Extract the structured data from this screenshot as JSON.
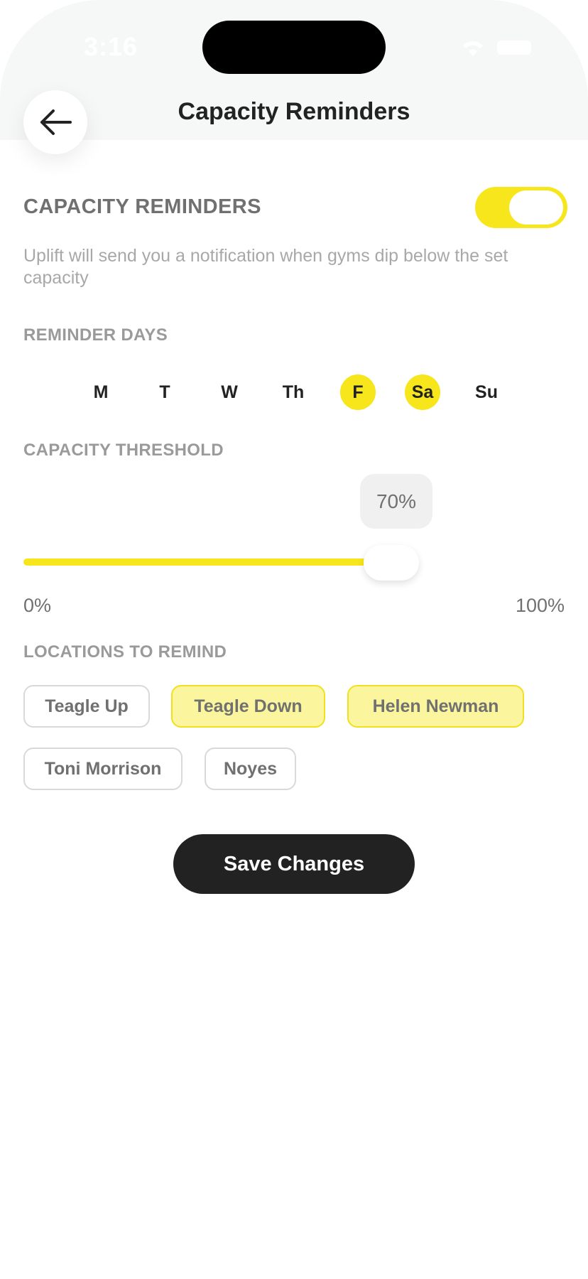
{
  "status_bar": {
    "time": "3:16",
    "wifi_icon": "wifi-icon",
    "battery_icon": "battery-icon"
  },
  "header": {
    "title": "Capacity Reminders",
    "back_icon": "arrow-left-icon"
  },
  "reminders": {
    "heading": "CAPACITY REMINDERS",
    "enabled": true,
    "description": "Uplift will send you a notification when gyms dip below the set capacity"
  },
  "days": {
    "heading": "REMINDER DAYS",
    "items": [
      {
        "label": "M",
        "selected": false
      },
      {
        "label": "T",
        "selected": false
      },
      {
        "label": "W",
        "selected": false
      },
      {
        "label": "Th",
        "selected": false
      },
      {
        "label": "F",
        "selected": true
      },
      {
        "label": "Sa",
        "selected": true
      },
      {
        "label": "Su",
        "selected": false
      }
    ]
  },
  "threshold": {
    "heading": "CAPACITY THRESHOLD",
    "value_label": "70%",
    "value": 70,
    "min_label": "0%",
    "max_label": "100%"
  },
  "locations": {
    "heading": "LOCATIONS TO REMIND",
    "items": [
      {
        "label": "Teagle Up",
        "selected": false
      },
      {
        "label": "Teagle Down",
        "selected": true
      },
      {
        "label": "Helen Newman",
        "selected": true
      },
      {
        "label": "Toni Morrison",
        "selected": false
      },
      {
        "label": "Noyes",
        "selected": false
      }
    ]
  },
  "save_label": "Save Changes",
  "colors": {
    "accent": "#f7e61c",
    "accent_light": "#fbf69e",
    "dark": "#222222",
    "muted": "#707070"
  }
}
